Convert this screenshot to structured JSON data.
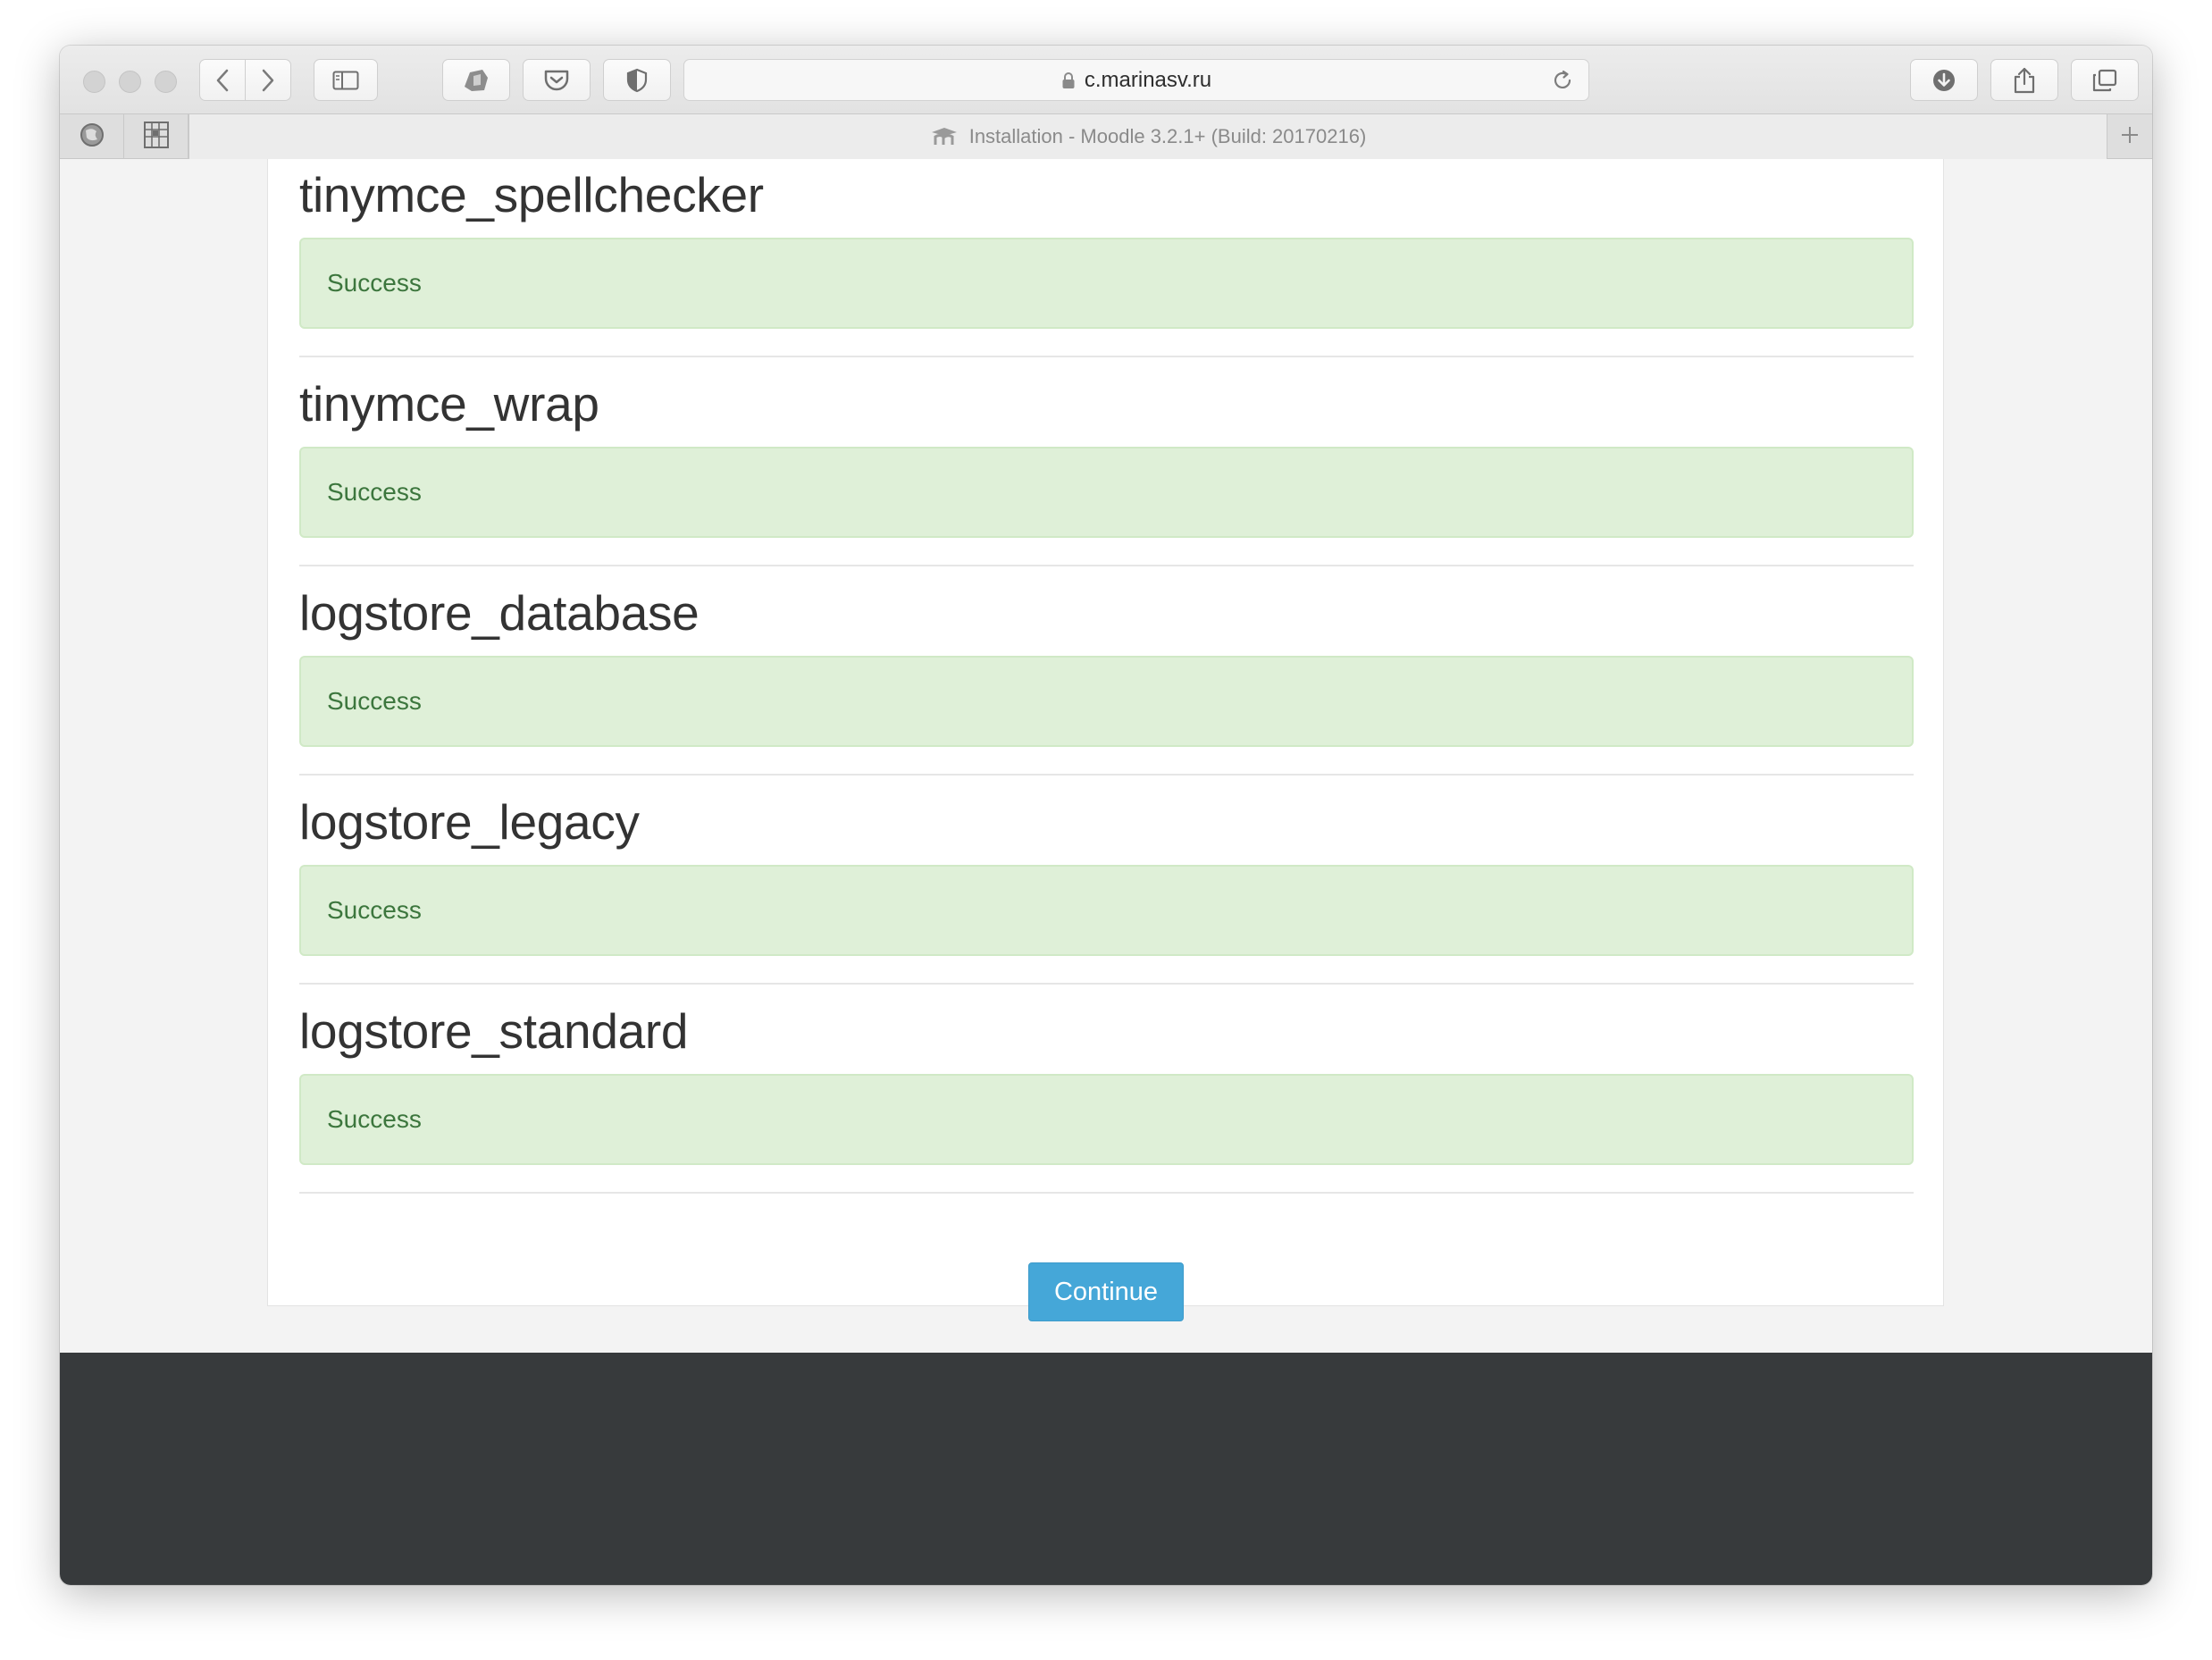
{
  "browser": {
    "url": "c.marinasv.ru",
    "tab_title": "Installation - Moodle 3.2.1+ (Build: 20170216)",
    "toolbar_icons": [
      "back-icon",
      "forward-icon",
      "sidebar-icon",
      "extension-icon",
      "pocket-icon",
      "shield-icon",
      "download-icon",
      "share-icon",
      "tabs-overview-icon"
    ]
  },
  "sections": [
    {
      "title": "tinymce_spellchecker",
      "status": "Success"
    },
    {
      "title": "tinymce_wrap",
      "status": "Success"
    },
    {
      "title": "logstore_database",
      "status": "Success"
    },
    {
      "title": "logstore_legacy",
      "status": "Success"
    },
    {
      "title": "logstore_standard",
      "status": "Success"
    }
  ],
  "actions": {
    "continue_label": "Continue"
  },
  "colors": {
    "success_bg": "#dff0d8",
    "success_text": "#3c763d",
    "button_primary": "#45a7d8",
    "footer_bg": "#373a3c"
  }
}
